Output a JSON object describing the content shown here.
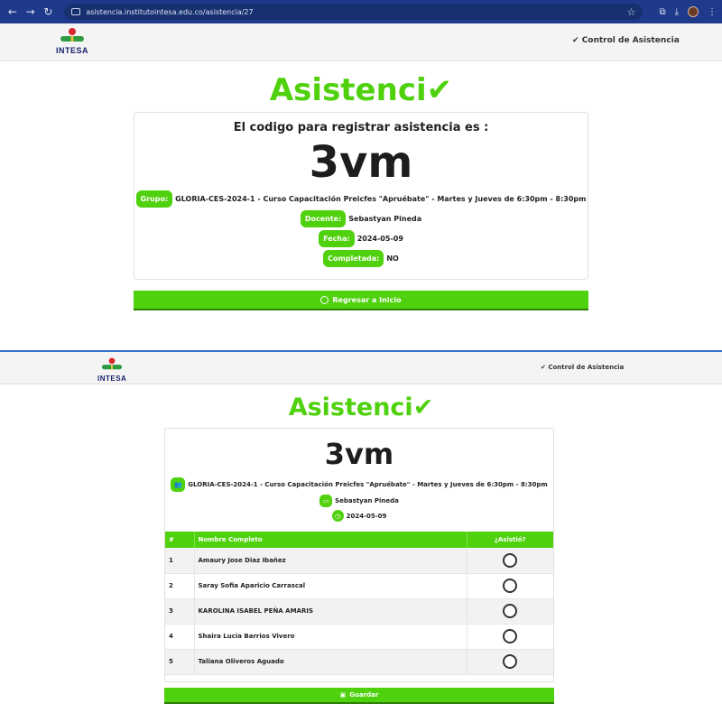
{
  "browser": {
    "url": "asistencia.institutointesa.edu.co/asistencia/27"
  },
  "logo": {
    "text": "INTESA"
  },
  "nav": {
    "link_label": "Control de Asistencia"
  },
  "top_section": {
    "title": "Asistenci",
    "subheading": "El codigo para registrar asistencia es :",
    "code": "3vm",
    "group_label": "Grupo:",
    "group_value": "GLORIA-CES-2024-1 - Curso Capacitación Preicfes \"Apruébate\" - Martes y Jueves de 6:30pm - 8:30pm",
    "teacher_label": "Docente:",
    "teacher_value": "Sebastyan Pineda",
    "date_label": "Fecha:",
    "date_value": "2024-05-09",
    "completed_label": "Completada:",
    "completed_value": "NO",
    "back_button": "Regresar a Inicio"
  },
  "bottom_section": {
    "title": "Asistenci",
    "code": "3vm",
    "group_value": "GLORIA-CES-2024-1 - Curso Capacitación Preicfes \"Apruébate\" - Martes y Jueves de 6:30pm - 8:30pm",
    "teacher_value": "Sebastyan Pineda",
    "date_value": "2024-05-09",
    "table": {
      "headers": [
        "#",
        "Nombre Completo",
        "¿Asistió?"
      ],
      "rows": [
        {
          "num": "1",
          "name": "Amaury Jose Diaz Ibañez"
        },
        {
          "num": "2",
          "name": "Saray Sofia Aparicio Carrascal"
        },
        {
          "num": "3",
          "name": "KAROLINA ISABEL PEÑA AMARIS"
        },
        {
          "num": "4",
          "name": "Shaira Lucia Barrios Vivero"
        },
        {
          "num": "5",
          "name": "Taliana Oliveros Aguado"
        }
      ]
    },
    "save_button": "Guardar"
  },
  "colors": {
    "accent": "#4fd10d",
    "browser_bar": "#1f3a8a"
  }
}
